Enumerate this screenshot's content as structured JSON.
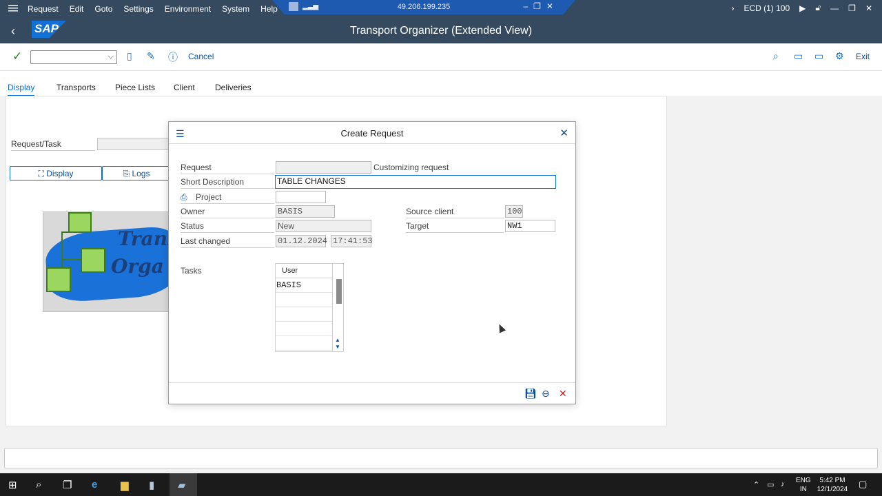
{
  "menubar": {
    "items": [
      "Request",
      "Edit",
      "Goto",
      "Settings",
      "Environment",
      "System",
      "Help"
    ],
    "rdp_ip": "49.206.199.235",
    "session": "ECD (1) 100"
  },
  "titlebar": {
    "logo": "SAP",
    "title": "Transport Organizer (Extended View)"
  },
  "toolbar": {
    "command_value": "",
    "cancel_label": "Cancel",
    "exit_label": "Exit"
  },
  "tabs": [
    "Display",
    "Transports",
    "Piece Lists",
    "Client",
    "Deliveries"
  ],
  "main": {
    "request_task_label": "Request/Task",
    "display_button": "Display",
    "logs_button": "Logs",
    "image_text_1": "Trans",
    "image_text_2": "Orga"
  },
  "dialog": {
    "title": "Create Request",
    "request_label": "Request",
    "request_value": "",
    "request_type": "Customizing request",
    "short_description_label": "Short Description",
    "short_description_value": "TABLE CHANGES",
    "project_label": "Project",
    "project_value": "",
    "owner_label": "Owner",
    "owner_value": "BASIS",
    "status_label": "Status",
    "status_value": "New",
    "last_changed_label": "Last changed",
    "last_changed_date": "01.12.2024",
    "last_changed_time": "17:41:53",
    "source_client_label": "Source client",
    "source_client_value": "100",
    "target_label": "Target",
    "target_value": "NW1",
    "tasks_label": "Tasks",
    "tasks_header": "User",
    "tasks_rows": [
      "BASIS",
      "",
      "",
      "",
      ""
    ]
  },
  "taskbar": {
    "lang_1": "ENG",
    "lang_2": "IN",
    "time": "5:42 PM",
    "date": "12/1/2024"
  }
}
